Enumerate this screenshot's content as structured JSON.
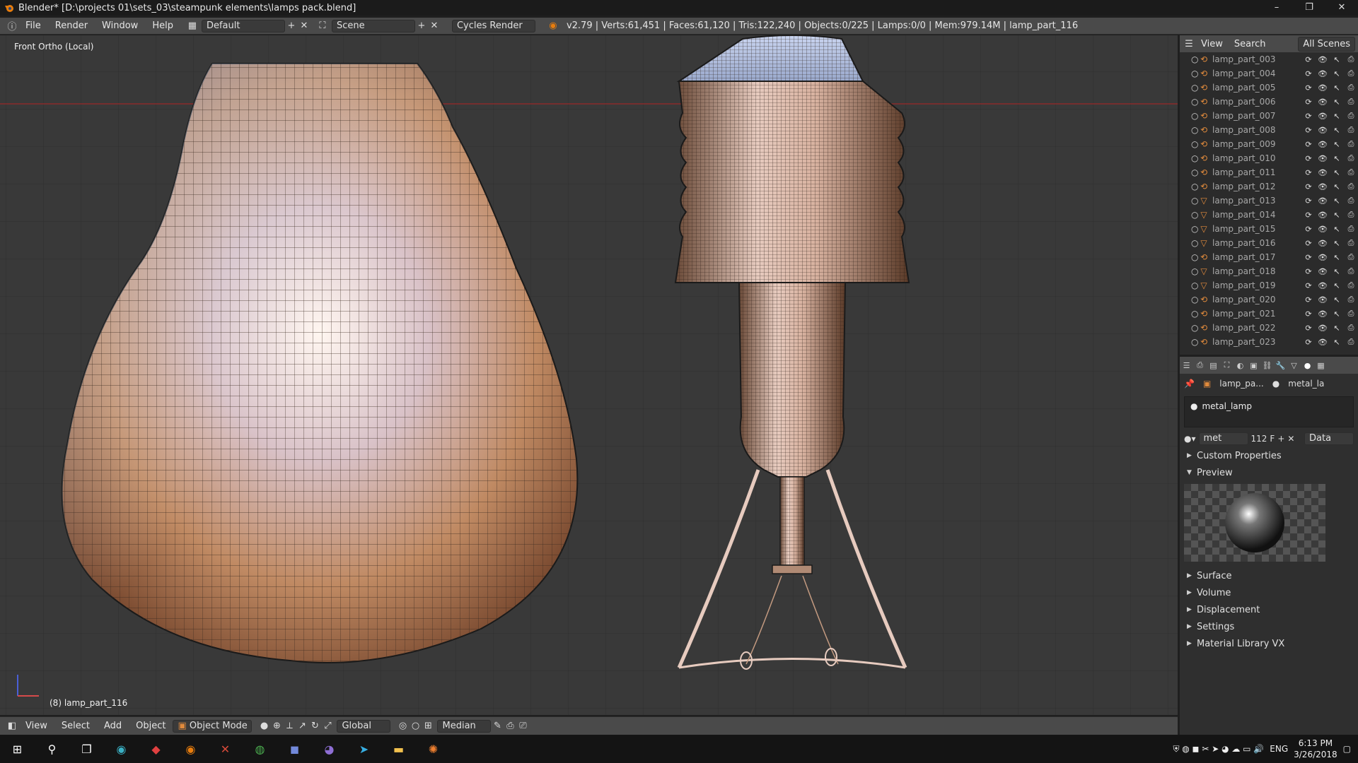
{
  "window": {
    "title": "Blender* [D:\\projects 01\\sets_03\\steampunk elements\\lamps pack.blend]",
    "controls": [
      "–",
      "❐",
      "✕"
    ]
  },
  "info_header": {
    "menus": [
      "File",
      "Render",
      "Window",
      "Help"
    ],
    "layout": "Default",
    "scene": "Scene",
    "engine": "Cycles Render",
    "stats": "v2.79 | Verts:61,451 | Faces:61,120 | Tris:122,240 | Objects:0/225 | Lamps:0/0 | Mem:979.14M | lamp_part_116"
  },
  "viewport": {
    "view_label": "Front Ortho (Local)",
    "object_label": "(8) lamp_part_116"
  },
  "view3d_header": {
    "menus": [
      "View",
      "Select",
      "Add",
      "Object"
    ],
    "mode": "Object Mode",
    "orientation": "Global",
    "pivot": "Median"
  },
  "outliner": {
    "menus": [
      "View",
      "Search"
    ],
    "display": "All Scenes",
    "items": [
      {
        "name": "lamp_part_003",
        "type": "curve"
      },
      {
        "name": "lamp_part_004",
        "type": "curve"
      },
      {
        "name": "lamp_part_005",
        "type": "curve"
      },
      {
        "name": "lamp_part_006",
        "type": "curve"
      },
      {
        "name": "lamp_part_007",
        "type": "curve"
      },
      {
        "name": "lamp_part_008",
        "type": "curve"
      },
      {
        "name": "lamp_part_009",
        "type": "curve"
      },
      {
        "name": "lamp_part_010",
        "type": "curve"
      },
      {
        "name": "lamp_part_011",
        "type": "curve"
      },
      {
        "name": "lamp_part_012",
        "type": "curve"
      },
      {
        "name": "lamp_part_013",
        "type": "mesh"
      },
      {
        "name": "lamp_part_014",
        "type": "mesh"
      },
      {
        "name": "lamp_part_015",
        "type": "mesh"
      },
      {
        "name": "lamp_part_016",
        "type": "mesh"
      },
      {
        "name": "lamp_part_017",
        "type": "curve"
      },
      {
        "name": "lamp_part_018",
        "type": "mesh"
      },
      {
        "name": "lamp_part_019",
        "type": "mesh"
      },
      {
        "name": "lamp_part_020",
        "type": "curve"
      },
      {
        "name": "lamp_part_021",
        "type": "curve"
      },
      {
        "name": "lamp_part_022",
        "type": "curve"
      },
      {
        "name": "lamp_part_023",
        "type": "curve"
      }
    ]
  },
  "properties": {
    "breadcrumb_object": "lamp_pa...",
    "breadcrumb_material": "metal_la",
    "material_slot": "metal_lamp",
    "datablock_name": "met",
    "users": "112",
    "fake_user": "F",
    "link": "Data",
    "panels": [
      {
        "label": "Custom Properties",
        "open": false
      },
      {
        "label": "Preview",
        "open": true
      }
    ],
    "panels_after": [
      {
        "label": "Surface",
        "open": false
      },
      {
        "label": "Volume",
        "open": false
      },
      {
        "label": "Displacement",
        "open": false
      },
      {
        "label": "Settings",
        "open": false
      },
      {
        "label": "Material Library VX",
        "open": false
      }
    ]
  },
  "taskbar": {
    "lang": "ENG",
    "time": "6:13 PM",
    "date": "3/26/2018"
  },
  "colors": {
    "accent_orange": "#e08a3c",
    "viewport_bg": "#393939",
    "header_bg": "#4a4a4a"
  }
}
